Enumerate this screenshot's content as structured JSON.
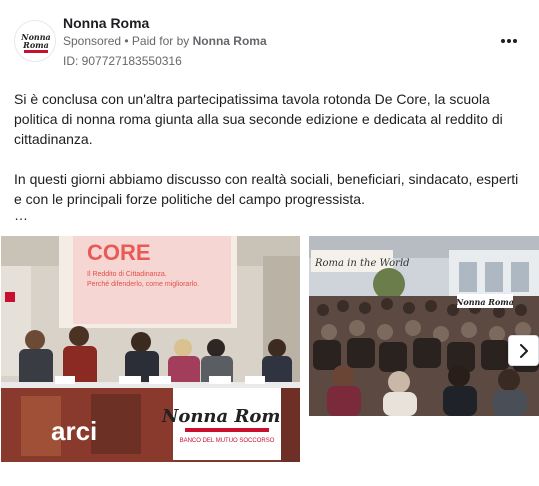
{
  "post": {
    "page_name": "Nonna Roma",
    "sponsored_label": "Sponsored",
    "separator": " • ",
    "paid_for_prefix": "Paid for by ",
    "paid_for_name": "Nonna Roma",
    "ad_id": "ID: 907727183550316",
    "avatar_logo_text": "Nonna Roma",
    "paragraph_1": "Si è conclusa con un'altra partecipatissima tavola rotonda De Core, la scuola politica di nonna roma giunta alla sua seconde edizione e dedicata al reddito di cittadinanza.",
    "paragraph_2": "In questi giorni abbiamo discusso con realtà sociali, beneficiari, sindacato, esperti e con le principali forze politiche del campo progressista.",
    "truncation": "…"
  },
  "media": {
    "photo1": {
      "screen_title": "CORE",
      "screen_line_1": "Il Reddito di Cittadinanza.",
      "screen_line_2": "Perché difenderlo, come migliorarlo.",
      "banner_title": "Nonna Roma",
      "banner_subtitle": "BANCO DEL MUTUO SOCCORSO",
      "arci_text": "arci"
    },
    "photo2": {
      "wall_text": "Roma in the World",
      "banner_title": "Nonna Roma"
    }
  },
  "icons": {
    "more": "more-horizontal-icon",
    "next": "chevron-right-icon"
  },
  "colors": {
    "text_primary": "#1c1e21",
    "text_secondary": "#65676b",
    "brand_red": "#c8102e"
  }
}
